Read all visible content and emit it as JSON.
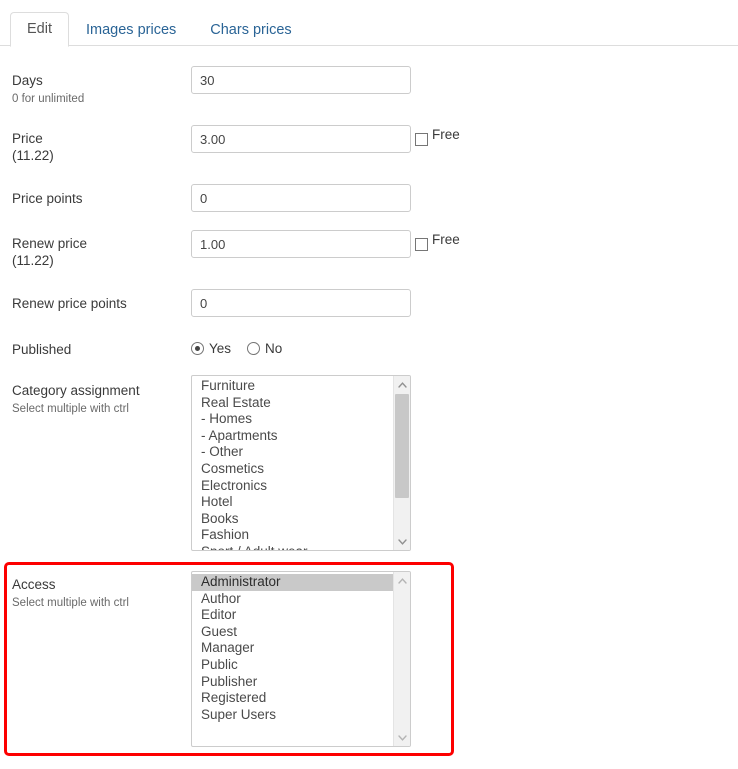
{
  "tabs": [
    {
      "label": "Edit",
      "active": true
    },
    {
      "label": "Images prices",
      "active": false
    },
    {
      "label": "Chars prices",
      "active": false
    }
  ],
  "form": {
    "days": {
      "label": "Days",
      "hint": "0 for unlimited",
      "value": "30"
    },
    "price": {
      "label": "Price",
      "currency_note": "(11.22)",
      "value": "3.00",
      "free_label": "Free",
      "free_checked": false
    },
    "price_points": {
      "label": "Price points",
      "value": "0"
    },
    "renew_price": {
      "label": "Renew price",
      "currency_note": "(11.22)",
      "value": "1.00",
      "free_label": "Free",
      "free_checked": false
    },
    "renew_price_points": {
      "label": "Renew price points",
      "value": "0"
    },
    "published": {
      "label": "Published",
      "yes_label": "Yes",
      "no_label": "No",
      "selected": "Yes"
    },
    "category_assignment": {
      "label": "Category assignment",
      "hint": "Select multiple with ctrl",
      "items": [
        "Furniture",
        "Real Estate",
        "- Homes",
        "- Apartments",
        "- Other",
        "Cosmetics",
        "Electronics",
        "Hotel",
        "Books",
        "Fashion",
        "Sport / Adult wear"
      ],
      "selected": []
    },
    "access": {
      "label": "Access",
      "hint": "Select multiple with ctrl",
      "items": [
        "Administrator",
        "Author",
        "Editor",
        "Guest",
        "Manager",
        "Public",
        "Publisher",
        "Registered",
        "Super Users"
      ],
      "selected": [
        "Administrator"
      ]
    }
  },
  "colors": {
    "tab_link": "#2a6496",
    "tab_active_text": "#555555",
    "label_text": "#3a3a3a",
    "hint_text": "#6a6a6a",
    "input_border": "#cccccc",
    "highlight_box": "#fd0000",
    "list_selected_bg": "#c9c9c9",
    "scrollbar_track": "#f1f1f1",
    "scrollbar_thumb": "#c8c8c8"
  }
}
